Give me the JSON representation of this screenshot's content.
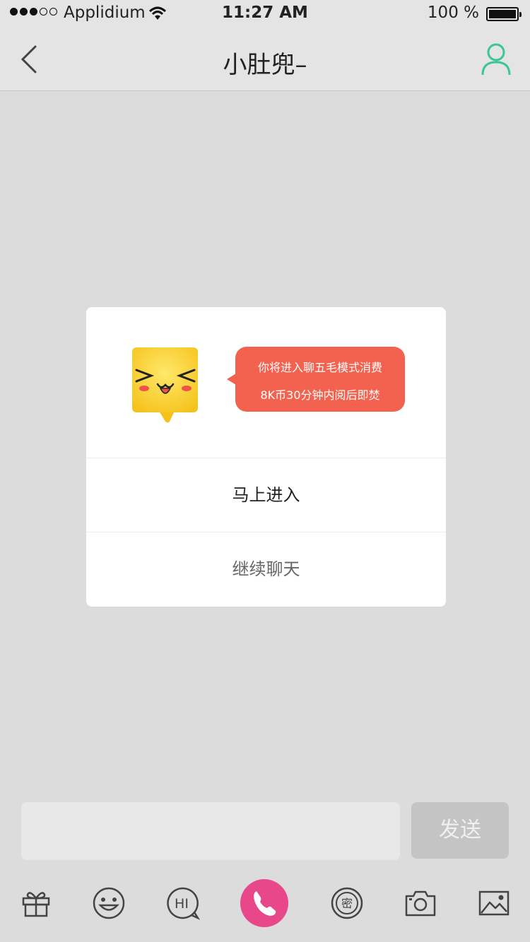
{
  "status_bar": {
    "carrier": "Applidium",
    "time": "11:27 AM",
    "battery": "100 %"
  },
  "nav": {
    "title": "小肚兜–",
    "back_icon": "chevron-left-icon",
    "profile_icon": "person-icon",
    "accent_color": "#3cc596"
  },
  "dialog": {
    "message_line1": "你将进入聊五毛模式消费",
    "message_line2": "8K币30分钟内阅后即焚",
    "primary_button": "马上进入",
    "secondary_button": "继续聊天",
    "bubble_color": "#f2624e"
  },
  "composer": {
    "input_value": "",
    "send_label": "发送"
  },
  "toolbar": {
    "icons": [
      "gift-icon",
      "emoji-icon",
      "hi-icon",
      "phone-call-icon",
      "secret-icon",
      "camera-icon",
      "image-icon"
    ],
    "hi_label": "HI",
    "secret_label": "密",
    "call_color": "#e8488a"
  }
}
